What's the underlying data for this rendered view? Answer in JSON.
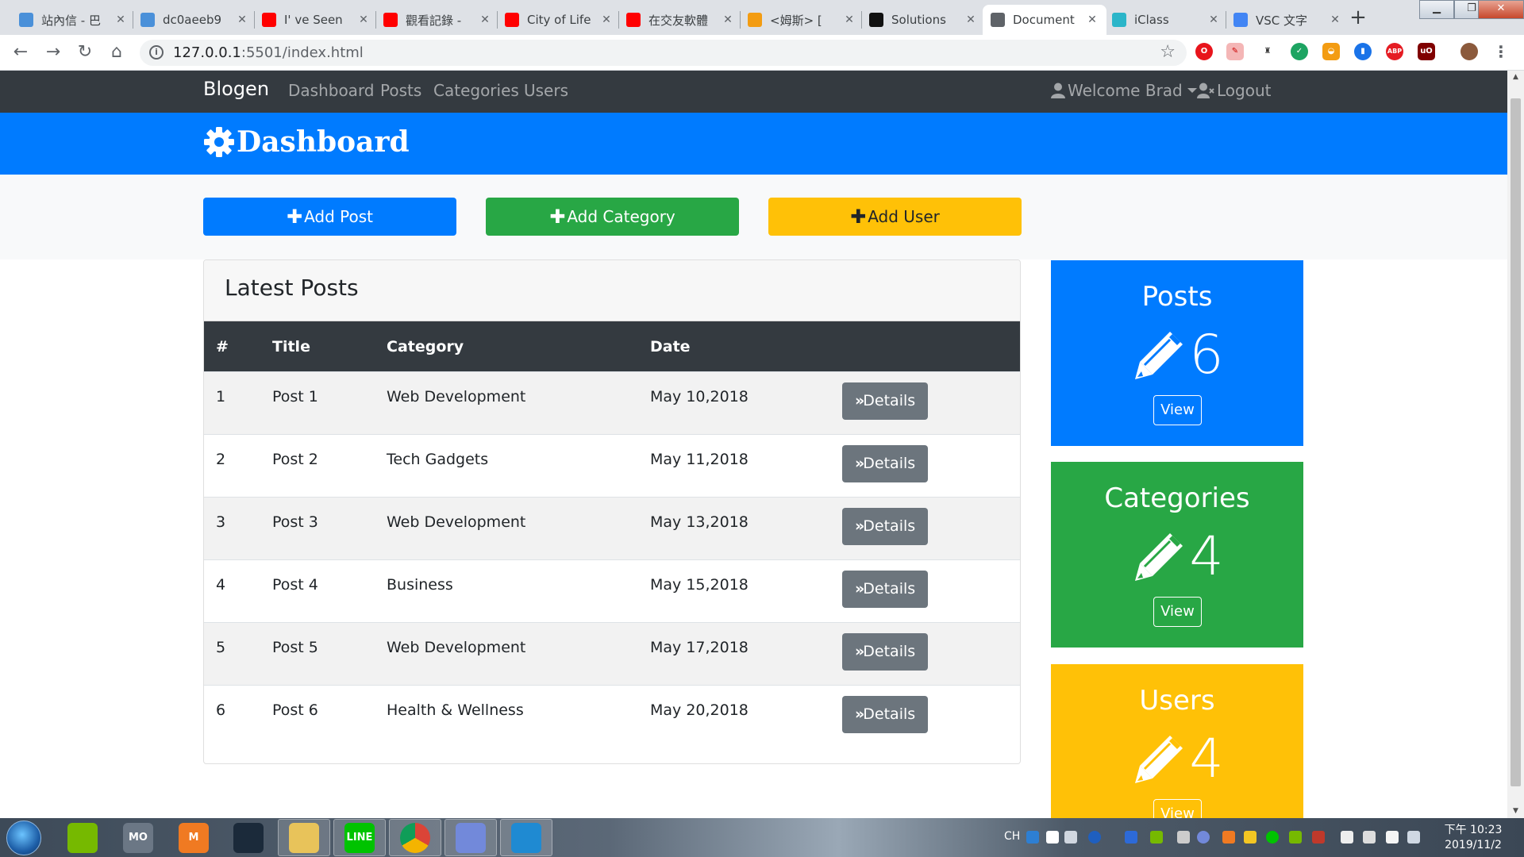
{
  "browser": {
    "tabs": [
      {
        "title": "站內信 - 巴",
        "favicon": "bahamut-icon",
        "color": "#4a90d9"
      },
      {
        "title": "dc0aeeb9",
        "favicon": "bahamut-icon",
        "color": "#4a90d9"
      },
      {
        "title": "I'   ve Seen",
        "favicon": "youtube-icon",
        "color": "#ff0000"
      },
      {
        "title": "觀看記錄 -",
        "favicon": "youtube-icon",
        "color": "#ff0000"
      },
      {
        "title": "City of Life",
        "favicon": "youtube-icon",
        "color": "#ff0000"
      },
      {
        "title": "在交友軟體",
        "favicon": "youtube-icon",
        "color": "#ff0000"
      },
      {
        "title": "<姆斯> [",
        "favicon": "rocket-icon",
        "color": "#f39c12"
      },
      {
        "title": "Solutions",
        "favicon": "s-icon",
        "color": "#111111"
      },
      {
        "title": "Document",
        "favicon": "globe-icon",
        "color": "#5f6368"
      },
      {
        "title": "iClass",
        "favicon": "iclass-icon",
        "color": "#2bb5c9"
      },
      {
        "title": "VSC 文字",
        "favicon": "google-icon",
        "color": "#4285f4"
      }
    ],
    "active_tab": 8,
    "url_host": "127.0.0.1",
    "url_rest": ":5501/index.html"
  },
  "site": {
    "brand": "Blogen",
    "nav": [
      "Dashboard",
      "Posts",
      "Categories",
      "Users"
    ],
    "welcome": "Welcome Brad",
    "logout": "Logout",
    "header_title": "Dashboard",
    "actions": [
      {
        "label": "Add Post",
        "color": "#007bff",
        "text_color": "#ffffff"
      },
      {
        "label": "Add Category",
        "color": "#28a745",
        "text_color": "#ffffff"
      },
      {
        "label": "Add User",
        "color": "#ffc107",
        "text_color": "#212529"
      }
    ],
    "posts_card_title": "Latest Posts",
    "table": {
      "headers": [
        "#",
        "Title",
        "Category",
        "Date"
      ],
      "details_label": "Details",
      "rows": [
        {
          "num": "1",
          "title": "Post 1",
          "category": "Web Development",
          "date": "May 10,2018"
        },
        {
          "num": "2",
          "title": "Post 2",
          "category": "Tech Gadgets",
          "date": "May 11,2018"
        },
        {
          "num": "3",
          "title": "Post 3",
          "category": "Web Development",
          "date": "May 13,2018"
        },
        {
          "num": "4",
          "title": "Post 4",
          "category": "Business",
          "date": "May 15,2018"
        },
        {
          "num": "5",
          "title": "Post 5",
          "category": "Web Development",
          "date": "May 17,2018"
        },
        {
          "num": "6",
          "title": "Post 6",
          "category": "Health & Wellness",
          "date": "May 20,2018"
        }
      ]
    },
    "stats": [
      {
        "title": "Posts",
        "count": "6",
        "view": "View",
        "color": "#007bff"
      },
      {
        "title": "Categories",
        "count": "4",
        "view": "View",
        "color": "#28a745"
      },
      {
        "title": "Users",
        "count": "4",
        "view": "View",
        "color": "#ffc107"
      }
    ]
  },
  "taskbar": {
    "lang": "CH",
    "time": "下午 10:23",
    "date": "2019/11/2",
    "apps": [
      {
        "name": "nvidia-icon",
        "label": "",
        "color": "#76b900"
      },
      {
        "name": "mo-icon",
        "label": "MO",
        "color": "#6b7785"
      },
      {
        "name": "m-icon",
        "label": "M",
        "color": "#f07a22"
      },
      {
        "name": "atom-icon",
        "label": "",
        "color": "#1b2a3a"
      },
      {
        "name": "folder-icon",
        "label": "",
        "color": "#e8c35a"
      },
      {
        "name": "line-icon",
        "label": "LINE",
        "color": "#00c300"
      },
      {
        "name": "chrome-icon",
        "label": "",
        "color": "#ffffff"
      },
      {
        "name": "discord-icon",
        "label": "",
        "color": "#7289da"
      },
      {
        "name": "vscode-icon",
        "label": "",
        "color": "#1f8ad2"
      }
    ]
  }
}
